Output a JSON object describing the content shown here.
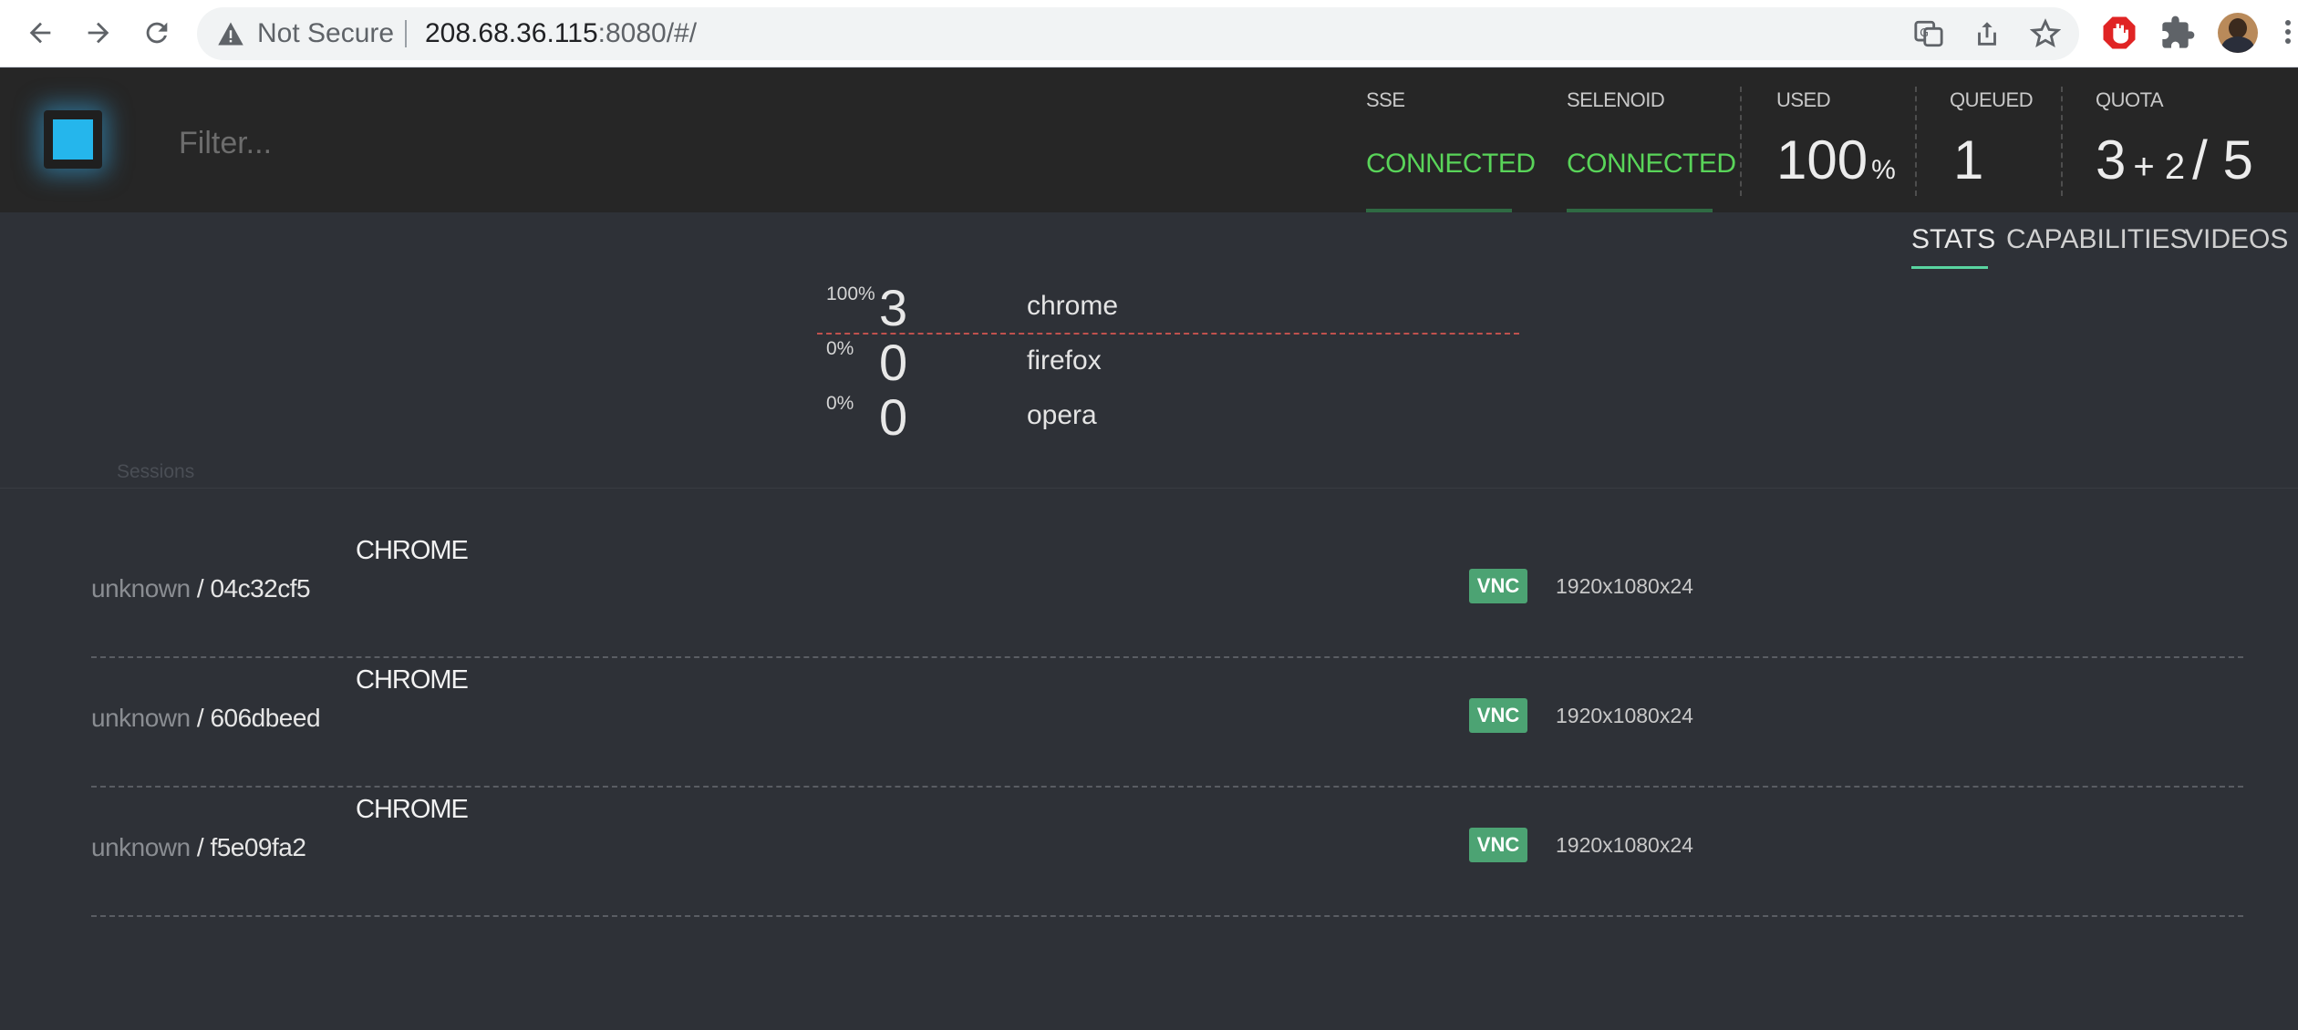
{
  "browser": {
    "security_label": "Not Secure",
    "url_host": "208.68.36.115",
    "url_rest": ":8080/#/"
  },
  "header": {
    "filter_placeholder": "Filter...",
    "sse": {
      "label": "SSE",
      "value": "CONNECTED"
    },
    "selenoid": {
      "label": "SELENOID",
      "value": "CONNECTED"
    },
    "used": {
      "label": "USED",
      "value": "100",
      "unit": "%"
    },
    "queued": {
      "label": "QUEUED",
      "value": "1"
    },
    "quota": {
      "label": "QUOTA",
      "used": "3",
      "plus": "+ 2",
      "slash": "/",
      "total": "5"
    }
  },
  "tabs": [
    {
      "label": "STATS",
      "active": true
    },
    {
      "label": "CAPABILITIES",
      "active": false
    },
    {
      "label": "VIDEOS",
      "active": false
    }
  ],
  "browsers": [
    {
      "percent": "100%",
      "count": "3",
      "name": "chrome"
    },
    {
      "percent": "0%",
      "count": "0",
      "name": "firefox"
    },
    {
      "percent": "0%",
      "count": "0",
      "name": "opera"
    }
  ],
  "sessions_title": "Sessions",
  "sessions": [
    {
      "owner": "unknown",
      "sep": " / ",
      "id": "04c32cf5",
      "browser": "CHROME",
      "vnc": "VNC",
      "resolution": "1920x1080x24"
    },
    {
      "owner": "unknown",
      "sep": " / ",
      "id": "606dbeed",
      "browser": "CHROME",
      "vnc": "VNC",
      "resolution": "1920x1080x24"
    },
    {
      "owner": "unknown",
      "sep": " / ",
      "id": "f5e09fa2",
      "browser": "CHROME",
      "vnc": "VNC",
      "resolution": "1920x1080x24"
    }
  ],
  "colors": {
    "accent_cyan": "#25b6ec",
    "connected_green": "#59d459",
    "vnc_green": "#4ca373",
    "dashed_red": "#c0514d"
  }
}
